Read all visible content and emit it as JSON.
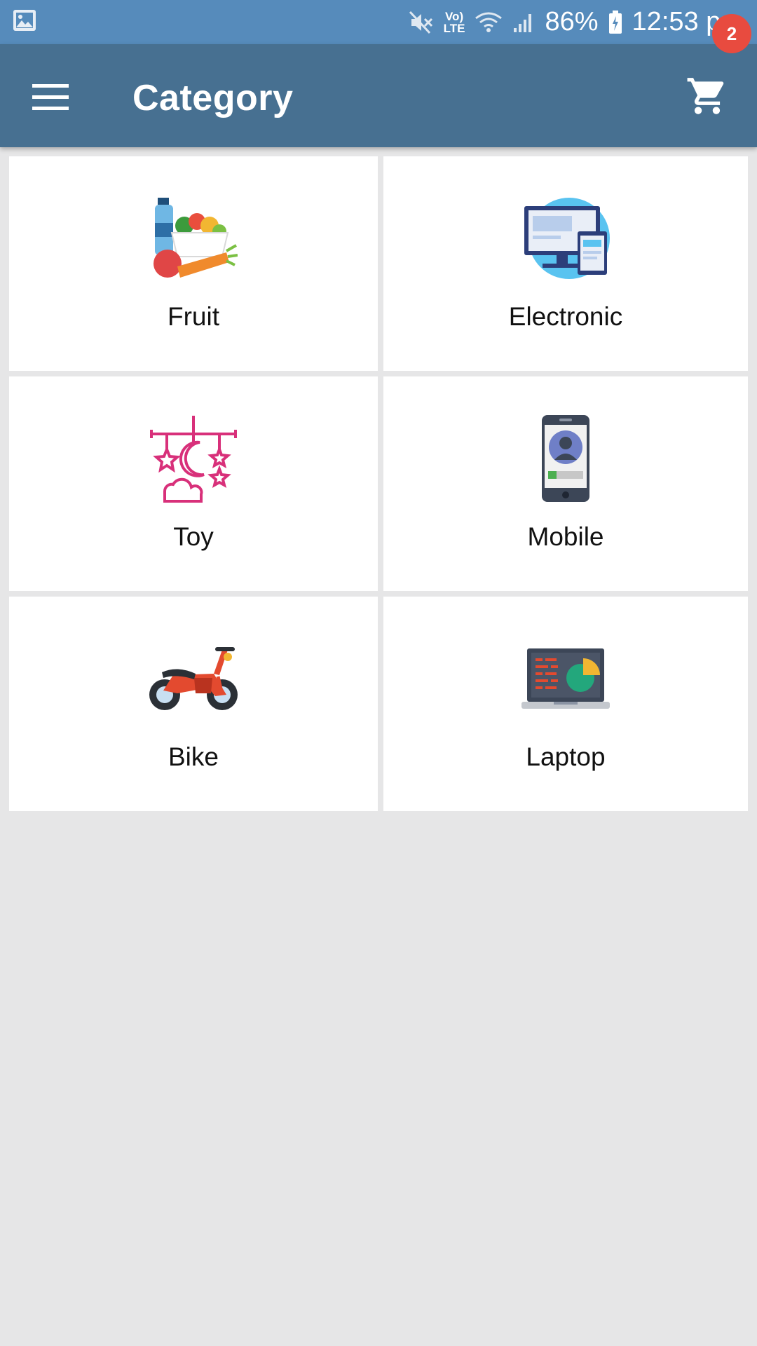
{
  "status_bar": {
    "battery": "86%",
    "time": "12:53 pm",
    "lte_top": "Vo)",
    "lte_bottom": "LTE",
    "icons": [
      "gallery-icon",
      "mute-icon",
      "volte-icon",
      "wifi-icon",
      "signal-icon",
      "battery-charging-icon"
    ]
  },
  "app_bar": {
    "title": "Category",
    "menu_icon": "hamburger-menu-icon",
    "cart_icon": "shopping-cart-icon",
    "cart_count": "2",
    "colors": {
      "status": "#568bbb",
      "toolbar": "#477091",
      "badge": "#e84b3f"
    }
  },
  "categories": [
    {
      "label": "Fruit",
      "icon": "fruit-basket-icon"
    },
    {
      "label": "Electronic",
      "icon": "electronic-devices-icon"
    },
    {
      "label": "Toy",
      "icon": "baby-mobile-toy-icon"
    },
    {
      "label": "Mobile",
      "icon": "smartphone-icon"
    },
    {
      "label": "Bike",
      "icon": "motorbike-icon"
    },
    {
      "label": "Laptop",
      "icon": "laptop-icon"
    }
  ]
}
